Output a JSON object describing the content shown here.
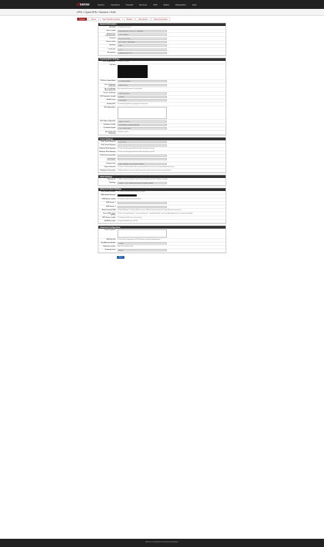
{
  "brand": {
    "name": "sense",
    "prefix": "pf"
  },
  "nav": [
    "System",
    "Interfaces",
    "Firewall",
    "Services",
    "VPN",
    "Status",
    "Diagnostics",
    "Help"
  ],
  "breadcrumb": "VPN / OpenVPN / Servers / Edit",
  "tabs": [
    "Servers",
    "Clients",
    "Client Specific Overrides",
    "Wizards",
    "Client Export",
    "Shared Key Export"
  ],
  "sections": [
    {
      "title": "General Information",
      "rows": [
        {
          "label": "Disabled",
          "kind": "check",
          "text": "Disable this server"
        },
        {
          "label": "Server mode",
          "kind": "box",
          "text": "Remote Access ( SSL/TLS + User Auth )"
        },
        {
          "label": "Backend for authentication",
          "kind": "box",
          "text": "Local Database"
        },
        {
          "label": "Protocol",
          "kind": "box",
          "text": "UDP on IPv4 only"
        },
        {
          "label": "Device mode",
          "kind": "box",
          "text": "tun - Layer 3 Tunnel Mode"
        },
        {
          "label": "Interface",
          "kind": "box",
          "text": "WAN"
        },
        {
          "label": "Local port",
          "kind": "box",
          "text": "1194"
        },
        {
          "label": "Description",
          "kind": "box",
          "text": "Remote Access VPN"
        }
      ]
    },
    {
      "title": "Cryptographic Settings",
      "rows": [
        {
          "label": "TLS Configuration",
          "kind": "check",
          "text": "Use a TLS Key"
        },
        {
          "label": "TLS Key",
          "kind": "black"
        },
        {
          "label": "TLS Key Usage Mode",
          "kind": "box",
          "text": "TLS Authentication"
        },
        {
          "label": "Peer Certificate Authority",
          "kind": "box",
          "text": "OpenVPN-CA"
        },
        {
          "label": "Peer Certificate Revocation list",
          "kind": "text",
          "text": "No Certificate Revocation Lists defined."
        },
        {
          "label": "Server certificate",
          "kind": "box",
          "text": "OpenVPN-Server"
        },
        {
          "label": "DH Parameter Length",
          "kind": "box",
          "text": "2048 bit"
        },
        {
          "label": "ECDH Curve",
          "kind": "box",
          "text": "Use Default"
        },
        {
          "label": "Enable NCP",
          "kind": "check",
          "text": "Enable Negotiable Cryptographic Parameters"
        },
        {
          "label": "NCP Algorithms",
          "kind": "list"
        },
        {
          "label": "Auth digest algorithm",
          "kind": "box",
          "text": "SHA256 (256-bit)"
        },
        {
          "label": "Hardware Crypto",
          "kind": "box",
          "text": "No Hardware Crypto Acceleration"
        },
        {
          "label": "Certificate Depth",
          "kind": "box",
          "text": "One (Client+Server)"
        },
        {
          "label": "Strict User-CN Matching",
          "kind": "check",
          "text": "Enforce match"
        }
      ]
    },
    {
      "title": "Tunnel Settings",
      "rows": [
        {
          "label": "IPv4 Tunnel Network",
          "kind": "box",
          "text": "10.0.8.0/24"
        },
        {
          "label": "IPv6 Tunnel Network",
          "kind": "box",
          "text": ""
        },
        {
          "label": "Redirect IPv4 Gateway",
          "kind": "check",
          "text": "Force all client-generated IPv4 traffic through the tunnel."
        },
        {
          "label": "Redirect IPv6 Gateway",
          "kind": "check",
          "text": "Force all client-generated IPv6 traffic through the tunnel."
        },
        {
          "label": "IPv4 Local network(s)",
          "kind": "box",
          "text": ""
        },
        {
          "label": "Concurrent connections",
          "kind": "box",
          "text": ""
        },
        {
          "label": "Compression",
          "kind": "box",
          "text": "Omit Preference (Use OpenVPN Default)"
        },
        {
          "label": "Type-of-Service",
          "kind": "check",
          "text": "Set the TOS IP header value of tunnel packets to match the encapsulated packet value."
        },
        {
          "label": "Duplicate Connection",
          "kind": "check",
          "text": "Allow multiple concurrent connections from clients using the same Common Name."
        }
      ]
    },
    {
      "title": "Client Settings",
      "rows": [
        {
          "label": "Dynamic IP",
          "kind": "check",
          "text": "Allow connected clients to retain their connections if their IP address changes."
        },
        {
          "label": "Topology",
          "kind": "box",
          "text": "Subnet -- One IP address per client in a common subnet"
        }
      ]
    },
    {
      "title": "Advanced Client Settings",
      "rows": [
        {
          "label": "DNS Default Domain",
          "kind": "check",
          "text": "Provide a default domain name to clients"
        },
        {
          "label": "DNS Default Domain",
          "kind": "blackline"
        },
        {
          "label": "DNS Server enable",
          "kind": "check",
          "text": "Provide a DNS server list to clients"
        },
        {
          "label": "DNS Server 1",
          "kind": "box",
          "text": ""
        },
        {
          "label": "DNS Server 2",
          "kind": "box",
          "text": ""
        },
        {
          "label": "Block Outside DNS",
          "kind": "check",
          "text": "Make Windows 10 Clients Block access to DNS servers except across OpenVPN while connected"
        },
        {
          "label": "Force DNS cache update",
          "kind": "check",
          "text": "Run \"net stop dnscache\", \"net start dnscache\", \"ipconfig /flushdns\" and \"ipconfig /registerdns\" on connection initiation."
        },
        {
          "label": "NTP Server enable",
          "kind": "check",
          "text": "Provide an NTP server list to clients"
        },
        {
          "label": "NetBIOS enable",
          "kind": "check",
          "text": "Enable NetBIOS over TCP/IP"
        }
      ]
    },
    {
      "title": "Advanced Configuration",
      "rows": [
        {
          "label": "Custom options",
          "kind": "ta"
        },
        {
          "label": "UDP Fast I/O",
          "kind": "check",
          "text": "Use fast I/O operations with UDP writes to tun/tap. Experimental."
        },
        {
          "label": "Send/Receive Buffer",
          "kind": "box",
          "text": "Default"
        },
        {
          "label": "Gateway creation",
          "kind": "text",
          "text": "Both   IPv4 only   IPv6 only"
        },
        {
          "label": "Verbosity level",
          "kind": "box",
          "text": "default"
        }
      ]
    }
  ],
  "save_label": "Save",
  "footer": "pfSense is developed and maintained by Netgate."
}
